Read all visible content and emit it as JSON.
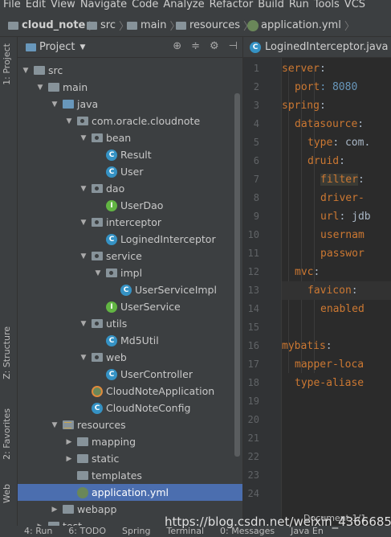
{
  "menu": [
    "File",
    "Edit",
    "View",
    "Navigate",
    "Code",
    "Analyze",
    "Refactor",
    "Build",
    "Run",
    "Tools",
    "VCS"
  ],
  "breadcrumb": [
    {
      "label": "cloud_note"
    },
    {
      "label": "src"
    },
    {
      "label": "main"
    },
    {
      "label": "resources"
    },
    {
      "label": "application.yml"
    }
  ],
  "left_tabs": {
    "project": "1: Project",
    "structure": "Z: Structure",
    "favorites": "2: Favorites",
    "web": "Web"
  },
  "project_panel": {
    "title": "Project"
  },
  "tree": [
    {
      "label": "src",
      "depth": 1,
      "arrow": "▼",
      "icon": "folder"
    },
    {
      "label": "main",
      "depth": 2,
      "arrow": "▼",
      "icon": "folder"
    },
    {
      "label": "java",
      "depth": 3,
      "arrow": "▼",
      "icon": "folder-blue"
    },
    {
      "label": "com.oracle.cloudnote",
      "depth": 4,
      "arrow": "▼",
      "icon": "package"
    },
    {
      "label": "bean",
      "depth": 5,
      "arrow": "▼",
      "icon": "package"
    },
    {
      "label": "Result",
      "depth": 6,
      "arrow": "",
      "icon": "class"
    },
    {
      "label": "User",
      "depth": 6,
      "arrow": "",
      "icon": "class"
    },
    {
      "label": "dao",
      "depth": 5,
      "arrow": "▼",
      "icon": "package"
    },
    {
      "label": "UserDao",
      "depth": 6,
      "arrow": "",
      "icon": "interface"
    },
    {
      "label": "interceptor",
      "depth": 5,
      "arrow": "▼",
      "icon": "package"
    },
    {
      "label": "LoginedInterceptor",
      "depth": 6,
      "arrow": "",
      "icon": "class"
    },
    {
      "label": "service",
      "depth": 5,
      "arrow": "▼",
      "icon": "package"
    },
    {
      "label": "impl",
      "depth": 6,
      "arrow": "▼",
      "icon": "package"
    },
    {
      "label": "UserServiceImpl",
      "depth": 7,
      "arrow": "",
      "icon": "class"
    },
    {
      "label": "UserService",
      "depth": 6,
      "arrow": "",
      "icon": "interface"
    },
    {
      "label": "utils",
      "depth": 5,
      "arrow": "▼",
      "icon": "package"
    },
    {
      "label": "Md5Util",
      "depth": 6,
      "arrow": "",
      "icon": "class"
    },
    {
      "label": "web",
      "depth": 5,
      "arrow": "▼",
      "icon": "package"
    },
    {
      "label": "UserController",
      "depth": 6,
      "arrow": "",
      "icon": "class"
    },
    {
      "label": "CloudNoteApplication",
      "depth": 5,
      "arrow": "",
      "icon": "spring"
    },
    {
      "label": "CloudNoteConfig",
      "depth": 5,
      "arrow": "",
      "icon": "class"
    },
    {
      "label": "resources",
      "depth": 3,
      "arrow": "▼",
      "icon": "resources"
    },
    {
      "label": "mapping",
      "depth": 4,
      "arrow": "▶",
      "icon": "folder"
    },
    {
      "label": "static",
      "depth": 4,
      "arrow": "▶",
      "icon": "folder"
    },
    {
      "label": "templates",
      "depth": 4,
      "arrow": "",
      "icon": "folder"
    },
    {
      "label": "application.yml",
      "depth": 4,
      "arrow": "",
      "icon": "yml",
      "selected": true
    },
    {
      "label": "webapp",
      "depth": 3,
      "arrow": "▶",
      "icon": "folder"
    },
    {
      "label": "test",
      "depth": 2,
      "arrow": "▶",
      "icon": "folder"
    }
  ],
  "editor_tab": {
    "label": "LoginedInterceptor.java"
  },
  "line_numbers": [
    "1",
    "2",
    "3",
    "4",
    "5",
    "6",
    "7",
    "8",
    "9",
    "10",
    "11",
    "12",
    "13",
    "14",
    "15",
    "16",
    "17",
    "18",
    "19",
    "20",
    "21",
    "22",
    "23",
    "24"
  ],
  "code_lines": [
    {
      "indent": 0,
      "key": "server",
      "rest": ":"
    },
    {
      "indent": 1,
      "key": "port",
      "rest": ": 8080"
    },
    {
      "indent": 0,
      "key": "spring",
      "rest": ":"
    },
    {
      "indent": 1,
      "key": "datasource",
      "rest": ":"
    },
    {
      "indent": 2,
      "key": "type",
      "rest": ": com."
    },
    {
      "indent": 2,
      "key": "druid",
      "rest": ":"
    },
    {
      "indent": 3,
      "key": "filter",
      "rest": ":"
    },
    {
      "indent": 3,
      "key": "driver-",
      "rest": ""
    },
    {
      "indent": 3,
      "key": "url",
      "rest": ": jdb"
    },
    {
      "indent": 3,
      "key": "usernam",
      "rest": ""
    },
    {
      "indent": 3,
      "key": "passwor",
      "rest": ""
    },
    {
      "indent": 1,
      "key": "mvc",
      "rest": ":"
    },
    {
      "indent": 2,
      "key": "favicon",
      "rest": ":"
    },
    {
      "indent": 3,
      "key": "enabled",
      "rest": ""
    },
    {
      "indent": 0,
      "key": "",
      "rest": ""
    },
    {
      "indent": 0,
      "key": "mybatis",
      "rest": ":"
    },
    {
      "indent": 1,
      "key": "mapper-loca",
      "rest": ""
    },
    {
      "indent": 1,
      "key": "type-aliase",
      "rest": ""
    }
  ],
  "bottom_tabs": [
    "4: Run",
    "6: TODO",
    "Spring",
    "Terminal",
    "0: Messages",
    "Java En"
  ],
  "doc_label": "Document 1/1",
  "watermark": "https://blog.csdn.net/weixin_43666859"
}
